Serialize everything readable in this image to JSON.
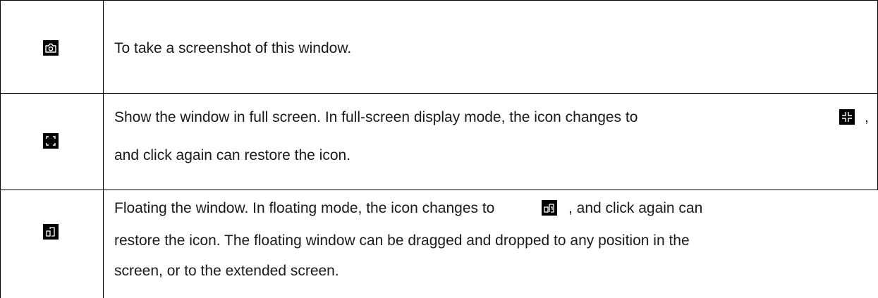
{
  "rows": [
    {
      "icon": "camera-icon",
      "lines": [
        "To take a screenshot of this window."
      ]
    },
    {
      "icon": "fullscreen-icon",
      "lines": [
        "Show the window in full screen. In full-screen display mode, the icon changes to",
        ",",
        "and click again can restore the icon."
      ],
      "inline_icon": "exit-fullscreen-icon"
    },
    {
      "icon": "float-window-icon",
      "lines": [
        "Floating the window. In floating mode, the icon changes to",
        ", and click again can",
        "restore the icon. The floating window can be dragged and dropped to any position in the",
        "screen, or to the extended screen."
      ],
      "inline_icon": "docked-window-icon"
    }
  ]
}
